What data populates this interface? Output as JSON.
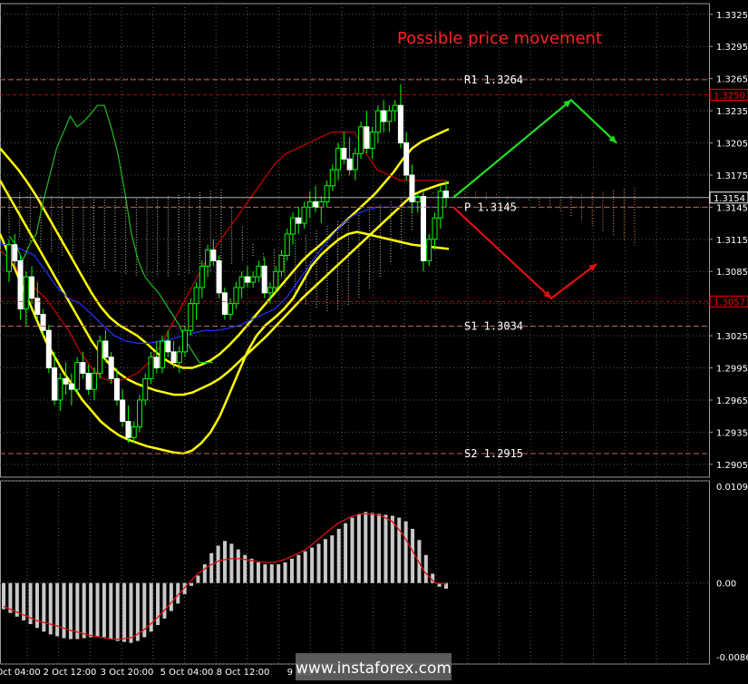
{
  "chart_data": [
    {
      "type": "line",
      "panel": "price",
      "title": "Possible price movement",
      "ylim": [
        1.2893,
        1.3335
      ],
      "y_ticks": [
        "1.3325",
        "1.3295",
        "1.3265",
        "1.3235",
        "1.3205",
        "1.3175",
        "1.3145",
        "1.3115",
        "1.3085",
        "1.3055",
        "1.3025",
        "1.2995",
        "1.2965",
        "1.2935",
        "1.2905"
      ],
      "x_ticks": [
        "Oct 04:00",
        "2 Oct 12:00",
        "3 Oct 20:00",
        "5 Oct 04:00",
        "8 Oct 12:00",
        "9 Oct"
      ],
      "price_badges": [
        {
          "value": "1.3250",
          "color": "#ff0000"
        },
        {
          "value": "1.3154",
          "color": "#ffffff"
        },
        {
          "value": "1.3057",
          "color": "#ff0000"
        }
      ],
      "levels": [
        {
          "label": "R1 1.3264",
          "value": 1.3264
        },
        {
          "label": "P 1.3145",
          "value": 1.3145
        },
        {
          "label": "S1 1.3034",
          "value": 1.3034
        },
        {
          "label": "S2 1.2915",
          "value": 1.2915
        }
      ],
      "candles": [
        [
          1.3085,
          1.3115,
          1.3075,
          1.311
        ],
        [
          1.311,
          1.312,
          1.309,
          1.3095
        ],
        [
          1.3095,
          1.31,
          1.304,
          1.305
        ],
        [
          1.305,
          1.3085,
          1.3035,
          1.308
        ],
        [
          1.308,
          1.309,
          1.3055,
          1.306
        ],
        [
          1.306,
          1.3075,
          1.304,
          1.3045
        ],
        [
          1.3045,
          1.305,
          1.3025,
          1.303
        ],
        [
          1.303,
          1.3035,
          1.299,
          1.2995
        ],
        [
          1.2995,
          1.301,
          1.296,
          1.2965
        ],
        [
          1.2965,
          1.299,
          1.2955,
          1.2985
        ],
        [
          1.2985,
          1.3,
          1.297,
          1.298
        ],
        [
          1.298,
          1.299,
          1.296,
          1.2975
        ],
        [
          1.2975,
          1.3005,
          1.297,
          1.3
        ],
        [
          1.3,
          1.301,
          1.2985,
          1.299
        ],
        [
          1.299,
          1.2998,
          1.297,
          1.2975
        ],
        [
          1.2975,
          1.2995,
          1.2965,
          1.299
        ],
        [
          1.299,
          1.3025,
          1.2985,
          1.302
        ],
        [
          1.302,
          1.303,
          1.3,
          1.3005
        ],
        [
          1.3005,
          1.301,
          1.298,
          1.2985
        ],
        [
          1.2985,
          1.2995,
          1.296,
          1.2965
        ],
        [
          1.2965,
          1.2975,
          1.294,
          1.2945
        ],
        [
          1.2945,
          1.296,
          1.2925,
          1.293
        ],
        [
          1.293,
          1.2945,
          1.2925,
          1.294
        ],
        [
          1.294,
          1.297,
          1.2935,
          1.2965
        ],
        [
          1.2965,
          1.299,
          1.296,
          1.2985
        ],
        [
          1.2985,
          1.301,
          1.298,
          1.3005
        ],
        [
          1.3005,
          1.302,
          1.299,
          1.2995
        ],
        [
          1.2995,
          1.3025,
          1.299,
          1.302
        ],
        [
          1.302,
          1.303,
          1.3005,
          1.301
        ],
        [
          1.301,
          1.302,
          1.2995,
          1.3
        ],
        [
          1.3,
          1.3015,
          1.299,
          1.301
        ],
        [
          1.301,
          1.3035,
          1.3005,
          1.303
        ],
        [
          1.303,
          1.306,
          1.3025,
          1.3055
        ],
        [
          1.3055,
          1.3075,
          1.304,
          1.307
        ],
        [
          1.307,
          1.3095,
          1.306,
          1.309
        ],
        [
          1.309,
          1.311,
          1.308,
          1.3105
        ],
        [
          1.3105,
          1.3115,
          1.309,
          1.3095
        ],
        [
          1.3095,
          1.31,
          1.306,
          1.3065
        ],
        [
          1.3065,
          1.307,
          1.304,
          1.3045
        ],
        [
          1.3045,
          1.306,
          1.304,
          1.3055
        ],
        [
          1.3055,
          1.3075,
          1.305,
          1.307
        ],
        [
          1.307,
          1.3085,
          1.306,
          1.308
        ],
        [
          1.308,
          1.309,
          1.307,
          1.3075
        ],
        [
          1.3075,
          1.3085,
          1.307,
          1.308
        ],
        [
          1.308,
          1.3095,
          1.3075,
          1.309
        ],
        [
          1.309,
          1.3098,
          1.306,
          1.3065
        ],
        [
          1.3065,
          1.3075,
          1.3055,
          1.307
        ],
        [
          1.307,
          1.309,
          1.3065,
          1.3085
        ],
        [
          1.3085,
          1.3105,
          1.308,
          1.31
        ],
        [
          1.31,
          1.3125,
          1.3095,
          1.312
        ],
        [
          1.312,
          1.314,
          1.311,
          1.3135
        ],
        [
          1.3135,
          1.3145,
          1.312,
          1.313
        ],
        [
          1.313,
          1.315,
          1.3125,
          1.3145
        ],
        [
          1.3145,
          1.316,
          1.3135,
          1.315
        ],
        [
          1.315,
          1.3165,
          1.314,
          1.3145
        ],
        [
          1.3145,
          1.3155,
          1.313,
          1.315
        ],
        [
          1.315,
          1.317,
          1.3145,
          1.3165
        ],
        [
          1.3165,
          1.3185,
          1.316,
          1.318
        ],
        [
          1.318,
          1.3205,
          1.317,
          1.32
        ],
        [
          1.32,
          1.3215,
          1.3185,
          1.319
        ],
        [
          1.319,
          1.321,
          1.3175,
          1.318
        ],
        [
          1.318,
          1.32,
          1.317,
          1.3195
        ],
        [
          1.3195,
          1.3225,
          1.319,
          1.322
        ],
        [
          1.322,
          1.3235,
          1.3195,
          1.32
        ],
        [
          1.32,
          1.322,
          1.319,
          1.3215
        ],
        [
          1.3215,
          1.324,
          1.3205,
          1.3235
        ],
        [
          1.3235,
          1.3245,
          1.3215,
          1.3225
        ],
        [
          1.3225,
          1.324,
          1.3215,
          1.3235
        ],
        [
          1.3235,
          1.3245,
          1.3225,
          1.324
        ],
        [
          1.324,
          1.326,
          1.32,
          1.3205
        ],
        [
          1.3205,
          1.3215,
          1.317,
          1.3175
        ],
        [
          1.3175,
          1.3185,
          1.314,
          1.315
        ],
        [
          1.315,
          1.3158,
          1.314,
          1.3155
        ],
        [
          1.3155,
          1.316,
          1.3085,
          1.3095
        ],
        [
          1.3095,
          1.312,
          1.309,
          1.3115
        ],
        [
          1.3115,
          1.314,
          1.3105,
          1.3135
        ],
        [
          1.3135,
          1.3165,
          1.3125,
          1.316
        ],
        [
          1.316,
          1.317,
          1.3145,
          1.3154
        ]
      ],
      "series": [
        {
          "name": "",
          "color": "#ffff00",
          "values": [
            1.32,
            1.319,
            1.318,
            1.3168,
            1.3155,
            1.314,
            1.3125,
            1.311,
            1.3095,
            1.308,
            1.3065,
            1.3052,
            1.3042,
            1.3035,
            1.303,
            1.3025,
            1.3018,
            1.301,
            1.3003,
            1.2998,
            1.2995,
            1.2995,
            1.2998,
            1.3002,
            1.3008,
            1.3016,
            1.3025,
            1.3035,
            1.3045,
            1.3055,
            1.3065,
            1.3075,
            1.3085,
            1.3095,
            1.3103,
            1.311,
            1.3118,
            1.3126,
            1.3134,
            1.3142,
            1.315,
            1.3158,
            1.3168,
            1.3178,
            1.319,
            1.32,
            1.3206,
            1.321,
            1.3214,
            1.3218
          ]
        },
        {
          "name": "",
          "color": "#ffff00",
          "values": [
            1.317,
            1.3155,
            1.314,
            1.3125,
            1.311,
            1.3095,
            1.308,
            1.3065,
            1.305,
            1.3035,
            1.302,
            1.3008,
            1.2998,
            1.299,
            1.2984,
            1.298,
            1.2977,
            1.2974,
            1.2972,
            1.297,
            1.297,
            1.2972,
            1.2976,
            1.298,
            1.2985,
            1.2992,
            1.3,
            1.3008,
            1.3016,
            1.3024,
            1.3033,
            1.3042,
            1.3051,
            1.306,
            1.3068,
            1.3076,
            1.3084,
            1.3092,
            1.31,
            1.3108,
            1.3116,
            1.3124,
            1.3132,
            1.314,
            1.3148,
            1.3156,
            1.316,
            1.3163,
            1.3166,
            1.3168
          ]
        },
        {
          "name": "",
          "color": "#ffff00",
          "values": [
            1.312,
            1.31,
            1.308,
            1.306,
            1.304,
            1.302,
            1.3005,
            1.299,
            1.2978,
            1.2965,
            1.2955,
            1.2945,
            1.2938,
            1.2932,
            1.2928,
            1.2925,
            1.2922,
            1.292,
            1.2918,
            1.2916,
            1.2915,
            1.2918,
            1.2925,
            1.2935,
            1.295,
            1.297,
            1.299,
            1.301,
            1.3025,
            1.3035,
            1.3042,
            1.305,
            1.306,
            1.3075,
            1.309,
            1.31,
            1.3108,
            1.3115,
            1.312,
            1.3122,
            1.312,
            1.3118,
            1.3116,
            1.3114,
            1.3112,
            1.311,
            1.3109,
            1.3108,
            1.3107,
            1.3106
          ]
        },
        {
          "name": "",
          "color": "#2233ff",
          "values": [
            1.311,
            1.311,
            1.3105,
            1.31,
            1.3085,
            1.307,
            1.306,
            1.3055,
            1.3045,
            1.3035,
            1.3025,
            1.302,
            1.3018,
            1.3018,
            1.302,
            1.3022,
            1.3025,
            1.3028,
            1.303,
            1.303,
            1.3032,
            1.3035,
            1.304,
            1.3045,
            1.305,
            1.306,
            1.3075,
            1.309,
            1.3105,
            1.3118,
            1.313,
            1.3138,
            1.3142,
            1.3145,
            1.3145,
            1.3145,
            1.3145,
            1.3145,
            1.3145,
            1.3145
          ]
        },
        {
          "name": "",
          "color": "#cc0000",
          "values": [
            1.3105,
            1.3095,
            1.308,
            1.307,
            1.306,
            1.3045,
            1.303,
            1.301,
            1.2995,
            1.2985,
            1.2982,
            1.2985,
            1.299,
            1.3,
            1.3015,
            1.3035,
            1.3055,
            1.3075,
            1.3095,
            1.311,
            1.3125,
            1.314,
            1.3155,
            1.317,
            1.3185,
            1.3195,
            1.32,
            1.3205,
            1.321,
            1.3215,
            1.3215,
            1.3215,
            1.3195,
            1.318,
            1.3175,
            1.317,
            1.317,
            1.317,
            1.317,
            1.317
          ]
        },
        {
          "name": "",
          "color": "#22bb22",
          "values": [
            1.3118,
            1.311,
            1.3095,
            1.311,
            1.312,
            1.315,
            1.3175,
            1.32,
            1.3215,
            1.323,
            1.322,
            1.3225,
            1.3232,
            1.324,
            1.324,
            1.322,
            1.3195,
            1.316,
            1.312,
            1.3095,
            1.308,
            1.3072,
            1.3065,
            1.3055,
            1.3045,
            1.3035,
            1.302,
            1.301,
            1.3,
            1.3,
            1.3
          ]
        }
      ],
      "forecast": {
        "up": [
          1.3154,
          1.3245,
          1.3205
        ],
        "down": [
          1.3145,
          1.306,
          1.3092
        ]
      }
    },
    {
      "type": "bar",
      "panel": "oscillator",
      "ylim": [
        -0.00867,
        0.01094
      ],
      "y_ticks": [
        "0.01094",
        "0.00",
        "-0.00867"
      ],
      "values": [
        -0.0028,
        -0.0032,
        -0.0036,
        -0.004,
        -0.0044,
        -0.0048,
        -0.0052,
        -0.0055,
        -0.0057,
        -0.0059,
        -0.006,
        -0.006,
        -0.0059,
        -0.0058,
        -0.0057,
        -0.0058,
        -0.006,
        -0.0062,
        -0.0063,
        -0.0064,
        -0.0062,
        -0.0058,
        -0.0052,
        -0.0045,
        -0.0038,
        -0.003,
        -0.0022,
        -0.0012,
        -0.0003,
        0.0008,
        0.002,
        0.0032,
        0.004,
        0.0045,
        0.0042,
        0.0036,
        0.003,
        0.0026,
        0.0022,
        0.002,
        0.002,
        0.002,
        0.0022,
        0.0026,
        0.003,
        0.0034,
        0.0038,
        0.0042,
        0.0047,
        0.0051,
        0.0058,
        0.0064,
        0.007,
        0.0074,
        0.0076,
        0.0075,
        0.0074,
        0.0073,
        0.0072,
        0.007,
        0.0066,
        0.0058,
        0.0046,
        0.003,
        0.001,
        -0.0004,
        -0.0006
      ],
      "signal": [
        -0.0025,
        -0.003,
        -0.0035,
        -0.004,
        -0.0043,
        -0.0046,
        -0.005,
        -0.0053,
        -0.0056,
        -0.0058,
        -0.006,
        -0.006,
        -0.0058,
        -0.005,
        -0.004,
        -0.0028,
        -0.0015,
        -0.0002,
        0.001,
        0.0018,
        0.0024,
        0.0026,
        0.0026,
        0.0024,
        0.0022,
        0.0022,
        0.0025,
        0.003,
        0.0036,
        0.0045,
        0.0055,
        0.0064,
        0.007,
        0.0074,
        0.0074,
        0.0072,
        0.0066,
        0.0052,
        0.0032,
        0.0012,
        0.0,
        -0.0001
      ]
    }
  ],
  "watermark": "www.instaforex.com"
}
